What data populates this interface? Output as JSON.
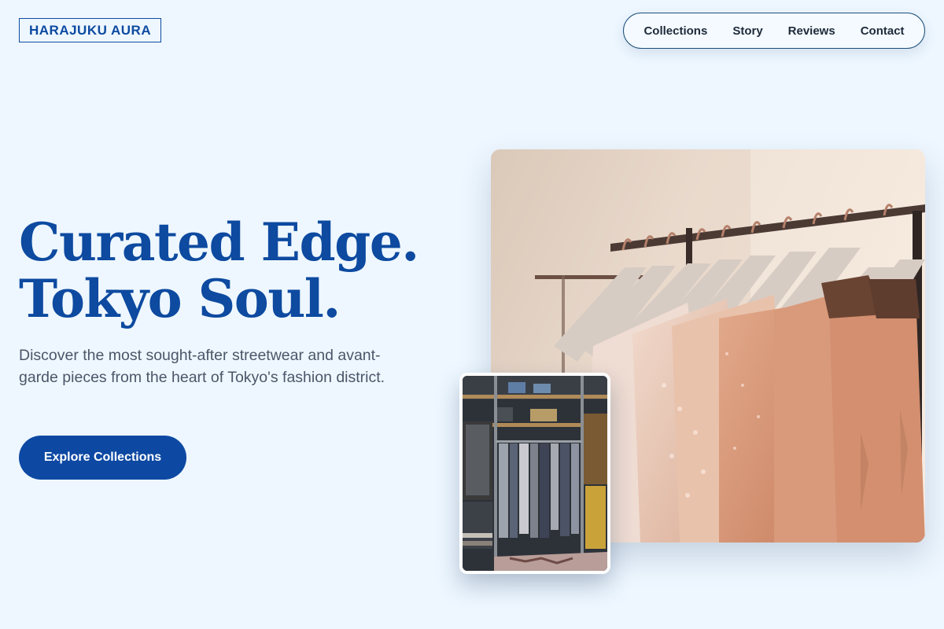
{
  "brand": {
    "name": "HARAJUKU AURA"
  },
  "nav": {
    "items": [
      {
        "label": "Collections"
      },
      {
        "label": "Story"
      },
      {
        "label": "Reviews"
      },
      {
        "label": "Contact"
      }
    ]
  },
  "hero": {
    "headline_line1": "Curated Edge.",
    "headline_line2": "Tokyo Soul.",
    "subtext": "Discover the most sought-after streetwear and avant-garde pieces from the heart of Tokyo's fashion district.",
    "cta_label": "Explore Collections"
  },
  "images": {
    "main": {
      "alt": "Clothing rack with peach and lace dresses on wooden hangers"
    },
    "inset": {
      "alt": "Boutique wardrobe with hanging garments and shelves"
    }
  },
  "colors": {
    "background": "#eef7ff",
    "brand_blue": "#0d4aa0",
    "button_blue": "#0d49a3",
    "body_text": "#4b5668"
  }
}
